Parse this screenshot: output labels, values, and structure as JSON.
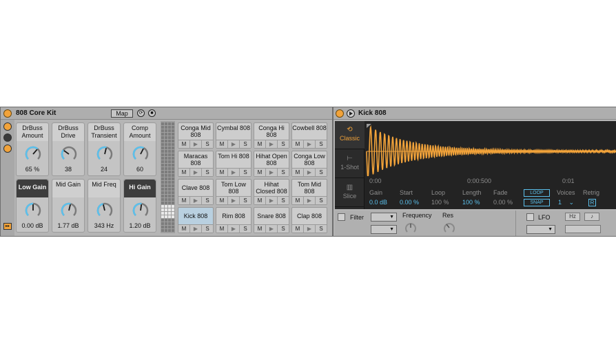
{
  "colors": {
    "accent_orange": "#f2a33a",
    "accent_blue": "#5bc0ec",
    "panel_bg": "#b5b5b5",
    "waveform_bg": "#232323"
  },
  "rack": {
    "title": "808 Core Kit",
    "map_label": "Map",
    "macros": [
      {
        "label": "DrBuss Amount",
        "value": "65 %",
        "level": 0.65,
        "style": "light"
      },
      {
        "label": "DrBuss Drive",
        "value": "38",
        "level": 0.3,
        "style": "light"
      },
      {
        "label": "DrBuss Transient",
        "value": "24",
        "level": 0.55,
        "style": "light"
      },
      {
        "label": "Comp Amount",
        "value": "60",
        "level": 0.6,
        "style": "light"
      },
      {
        "label": "Low Gain",
        "value": "0.00 dB",
        "level": 0.5,
        "style": "dark"
      },
      {
        "label": "Mid Gain",
        "value": "1.77 dB",
        "level": 0.55,
        "style": "light"
      },
      {
        "label": "Mid Freq",
        "value": "343 Hz",
        "level": 0.45,
        "style": "light"
      },
      {
        "label": "Hi Gain",
        "value": "1.20 dB",
        "level": 0.53,
        "style": "dark"
      }
    ],
    "pad_buttons": {
      "mute": "M",
      "play": "▶",
      "solo": "S"
    },
    "pads": [
      [
        "Conga Mid 808",
        "Cymbal 808",
        "Conga Hi 808",
        "Cowbell 808"
      ],
      [
        "Maracas 808",
        "Tom Hi 808",
        "Hihat Open 808",
        "Conga Low 808"
      ],
      [
        "Clave 808",
        "Tom Low 808",
        "Hihat Closed 808",
        "Tom Mid 808"
      ],
      [
        "Kick 808",
        "Rim 808",
        "Snare 808",
        "Clap 808"
      ]
    ],
    "selected_pad": "Kick 808"
  },
  "simpler": {
    "title": "Kick 808",
    "modes": [
      {
        "label": "Classic",
        "icon": "loop-icon",
        "active": true
      },
      {
        "label": "1-Shot",
        "icon": "one-shot-icon",
        "active": false
      },
      {
        "label": "Slice",
        "icon": "slice-icon",
        "active": false
      }
    ],
    "timeline": [
      "0:00",
      "0:00:500",
      "0:01"
    ],
    "params": [
      {
        "label": "Gain",
        "value": "0.0 dB",
        "highlight": true
      },
      {
        "label": "Start",
        "value": "0.00 %",
        "highlight": true
      },
      {
        "label": "Loop",
        "value": "100 %",
        "highlight": false
      },
      {
        "label": "Length",
        "value": "100 %",
        "highlight": true
      },
      {
        "label": "Fade",
        "value": "0.00 %",
        "highlight": false
      }
    ],
    "loop_label": "LOOP",
    "snap_label": "SNAP",
    "voices_label": "Voices",
    "voices_value": "1",
    "retrig_label": "Retrig",
    "retrig_value": "R",
    "filter_label": "Filter",
    "frequency_label": "Frequency",
    "res_label": "Res",
    "lfo_label": "LFO",
    "lfo_hz": "Hz",
    "lfo_note": "♪"
  }
}
